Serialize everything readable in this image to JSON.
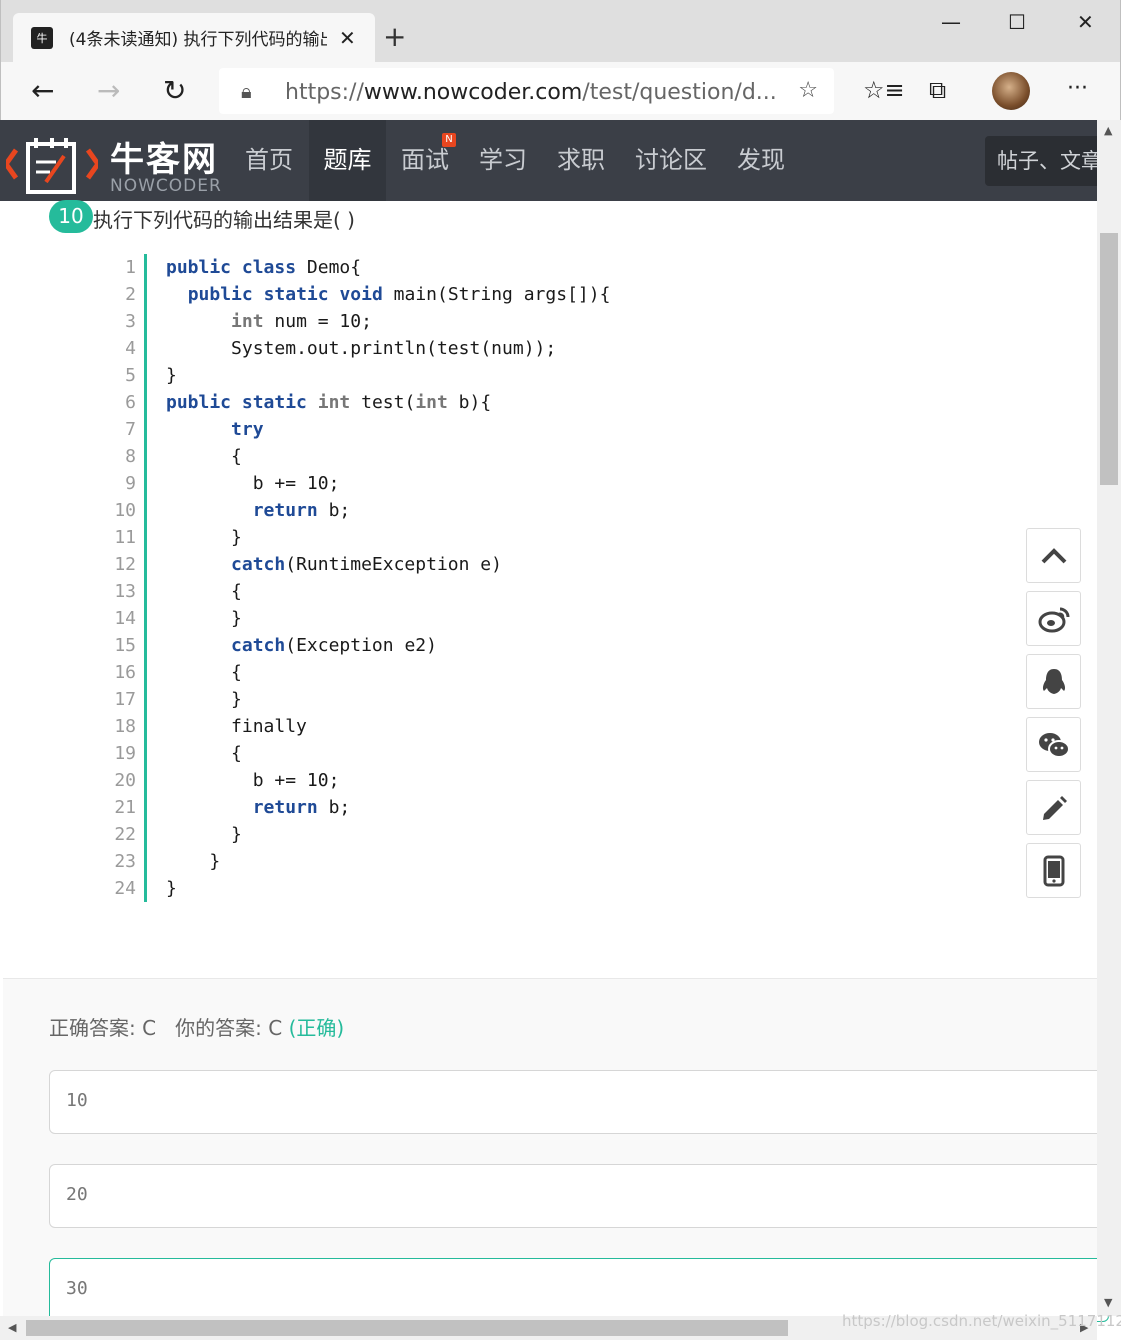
{
  "browser": {
    "tab_title": "(4条未读通知) 执行下列代码的输出",
    "tab_close": "✕",
    "new_tab": "+",
    "url_scheme": "https://",
    "url_host": "www.nowcoder.com",
    "url_path": "/test/question/d...",
    "minimize": "—",
    "maximize": "☐",
    "close": "✕",
    "more": "···"
  },
  "site": {
    "logo_cn": "牛客网",
    "logo_en": "NOWCODER",
    "nav": [
      "首页",
      "题库",
      "面试",
      "学习",
      "求职",
      "讨论区",
      "发现"
    ],
    "active_nav": "题库",
    "new_badge": "N",
    "search_placeholder": "帖子、文章"
  },
  "question": {
    "number": "10",
    "title": "执行下列代码的输出结果是( )",
    "code_lines": [
      "public class Demo{",
      "  public static void main(String args[]){",
      "      int num = 10;",
      "      System.out.println(test(num));",
      "}",
      "public static int test(int b){",
      "      try",
      "      {",
      "        b += 10;",
      "        return b;",
      "      }",
      "      catch(RuntimeException e)",
      "      {",
      "      }",
      "      catch(Exception e2)",
      "      {",
      "      }",
      "      finally",
      "      {",
      "        b += 10;",
      "        return b;",
      "      }",
      "    }",
      "}"
    ]
  },
  "result": {
    "correct_label": "正确答案: C",
    "your_label": "你的答案: C",
    "status": "(正确)"
  },
  "options": [
    "10",
    "20",
    "30"
  ],
  "selected_option": "30",
  "side_toolbar": [
    "back-to-top",
    "weibo",
    "qq",
    "wechat",
    "edit",
    "mobile"
  ],
  "watermark": "https://blog.csdn.net/weixin_51171129",
  "colors": {
    "accent": "#25bb9b",
    "header_bg": "#3b3f47",
    "keyword": "#1f4a96"
  }
}
